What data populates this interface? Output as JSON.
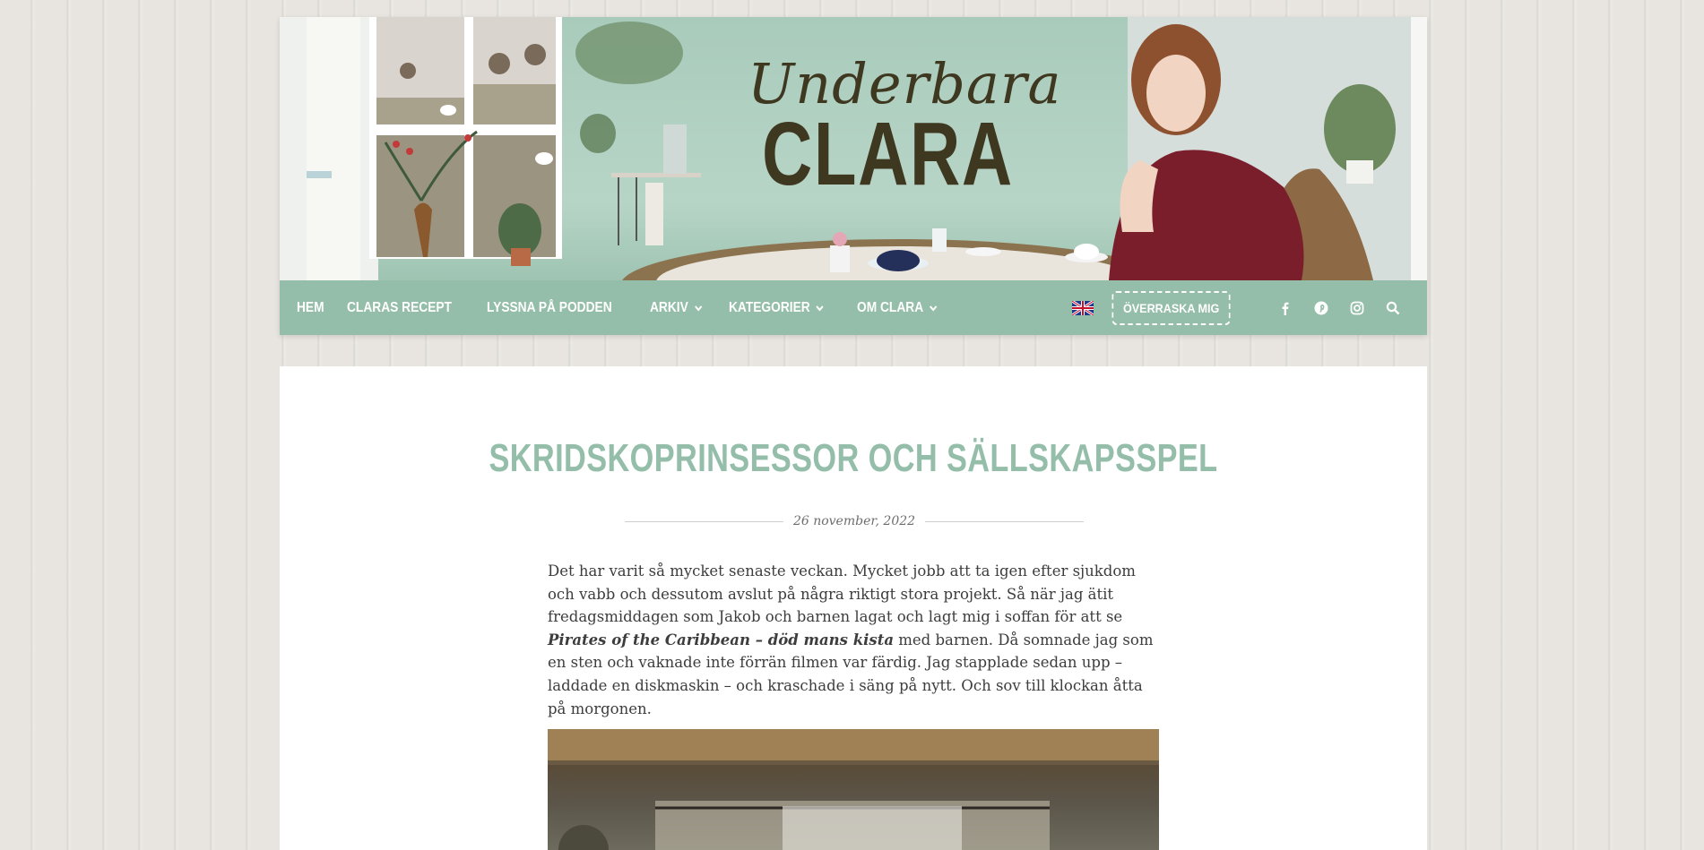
{
  "header": {
    "brand_script": "Underbara",
    "brand_main": "CLARA"
  },
  "nav": {
    "items": [
      {
        "label": "HEM",
        "has_dropdown": false
      },
      {
        "label": "CLARAS RECEPT",
        "has_dropdown": false
      },
      {
        "label": "LYSSNA PÅ PODDEN",
        "has_dropdown": false
      },
      {
        "label": "ARKIV",
        "has_dropdown": true
      },
      {
        "label": "KATEGORIER",
        "has_dropdown": true
      },
      {
        "label": "OM CLARA",
        "has_dropdown": true
      }
    ],
    "language_icon": "uk-flag-icon",
    "surprise_label": "ÖVERRASKA MIG",
    "social_icons": [
      "facebook-icon",
      "pinterest-icon",
      "instagram-icon",
      "search-icon"
    ]
  },
  "post": {
    "title": "SKRIDSKOPRINSESSOR OCH SÄLLSKAPSSPEL",
    "date": "26 november, 2022",
    "para_1": "Det har varit så mycket senaste veckan. Mycket jobb att ta igen efter sjukdom och vabb och dessutom avslut på några riktigt stora projekt. Så när jag ätit fredagsmiddagen som Jakob och barnen lagat och lagt mig i soffan för att se ",
    "para_emphasis": "Pirates of the Caribbean – död mans kista",
    "para_2": " med barnen. Då somnade jag som en sten och vaknade inte förrän filmen var färdig. Jag stapplade sedan upp – laddade en diskmaskin – och kraschade i säng på nytt. Och sov till klockan åtta på morgonen."
  },
  "colors": {
    "accent": "#94bea9",
    "text": "#3d3d3d",
    "brand_dark": "#3f3820"
  }
}
